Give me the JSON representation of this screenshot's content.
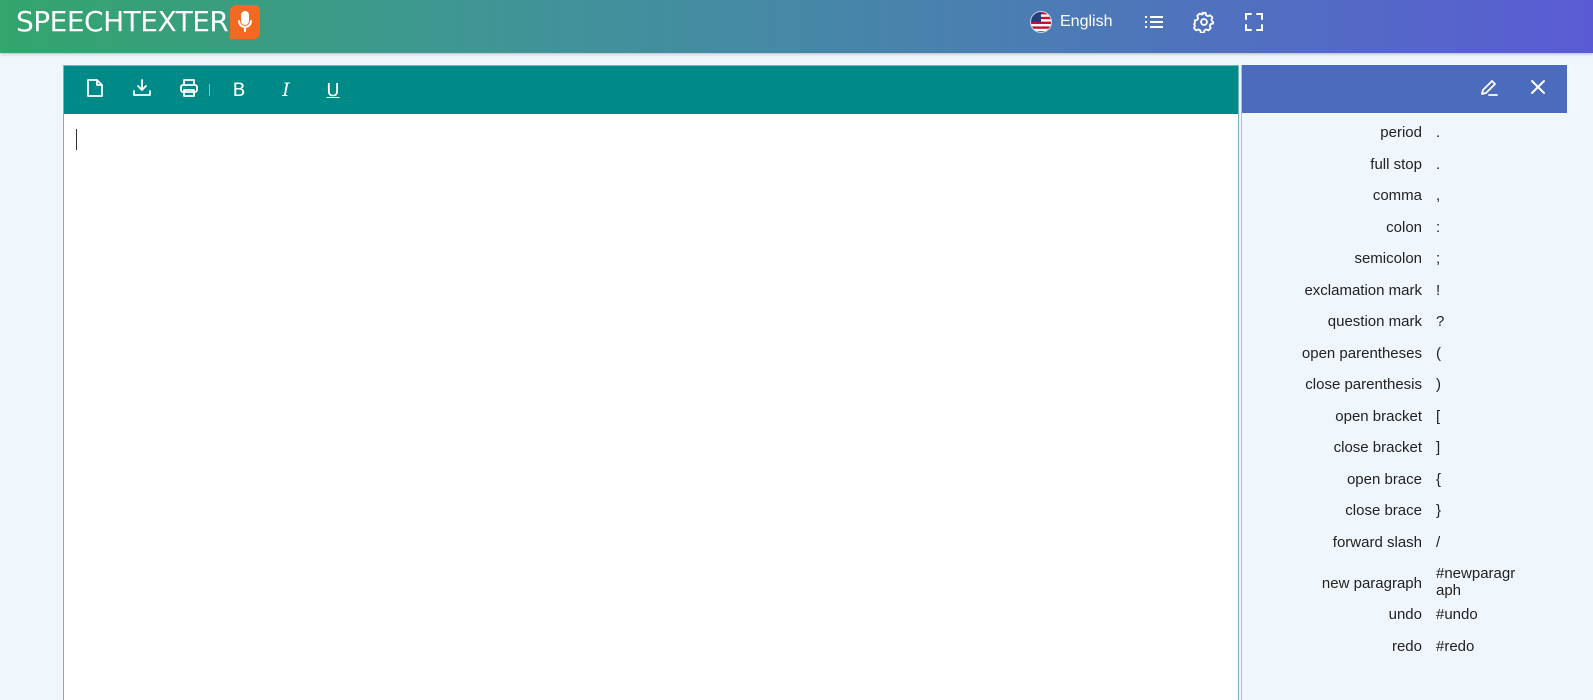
{
  "header": {
    "logo_text": "SPEECHTEXTER",
    "logo_icon": "microphone-icon",
    "language": "English",
    "language_icon": "us-flag-icon",
    "nav_icons": [
      "list-icon",
      "gear-icon",
      "fullscreen-icon"
    ]
  },
  "toolbar": {
    "icons": [
      "new-document-icon",
      "download-icon",
      "print-icon",
      "bold-icon",
      "italic-icon",
      "underline-icon"
    ],
    "bold_glyph": "B",
    "italic_glyph": "I",
    "underline_glyph": "U"
  },
  "editor": {
    "content": ""
  },
  "panel": {
    "icons": [
      "edit-pencil-icon",
      "close-icon"
    ],
    "commands": [
      {
        "name": "period",
        "symbol": "."
      },
      {
        "name": "full stop",
        "symbol": "."
      },
      {
        "name": "comma",
        "symbol": ","
      },
      {
        "name": "colon",
        "symbol": ":"
      },
      {
        "name": "semicolon",
        "symbol": ";"
      },
      {
        "name": "exclamation mark",
        "symbol": "!"
      },
      {
        "name": "question mark",
        "symbol": "?"
      },
      {
        "name": "open parentheses",
        "symbol": "("
      },
      {
        "name": "close parenthesis",
        "symbol": ")"
      },
      {
        "name": "open bracket",
        "symbol": "["
      },
      {
        "name": "close bracket",
        "symbol": "]"
      },
      {
        "name": "open brace",
        "symbol": "{"
      },
      {
        "name": "close brace",
        "symbol": "}"
      },
      {
        "name": "forward slash",
        "symbol": "/"
      },
      {
        "name": "new paragraph",
        "symbol": "#newparagraph"
      },
      {
        "name": "undo",
        "symbol": "#undo"
      },
      {
        "name": "redo",
        "symbol": "#redo"
      }
    ]
  },
  "colors": {
    "header_gradient_start": "#33a56d",
    "header_gradient_end": "#5a5bd4",
    "toolbar": "#008a87",
    "panel_header": "#4b6bbd",
    "logo_accent": "#f26a21",
    "page_background": "#eff6fc"
  }
}
